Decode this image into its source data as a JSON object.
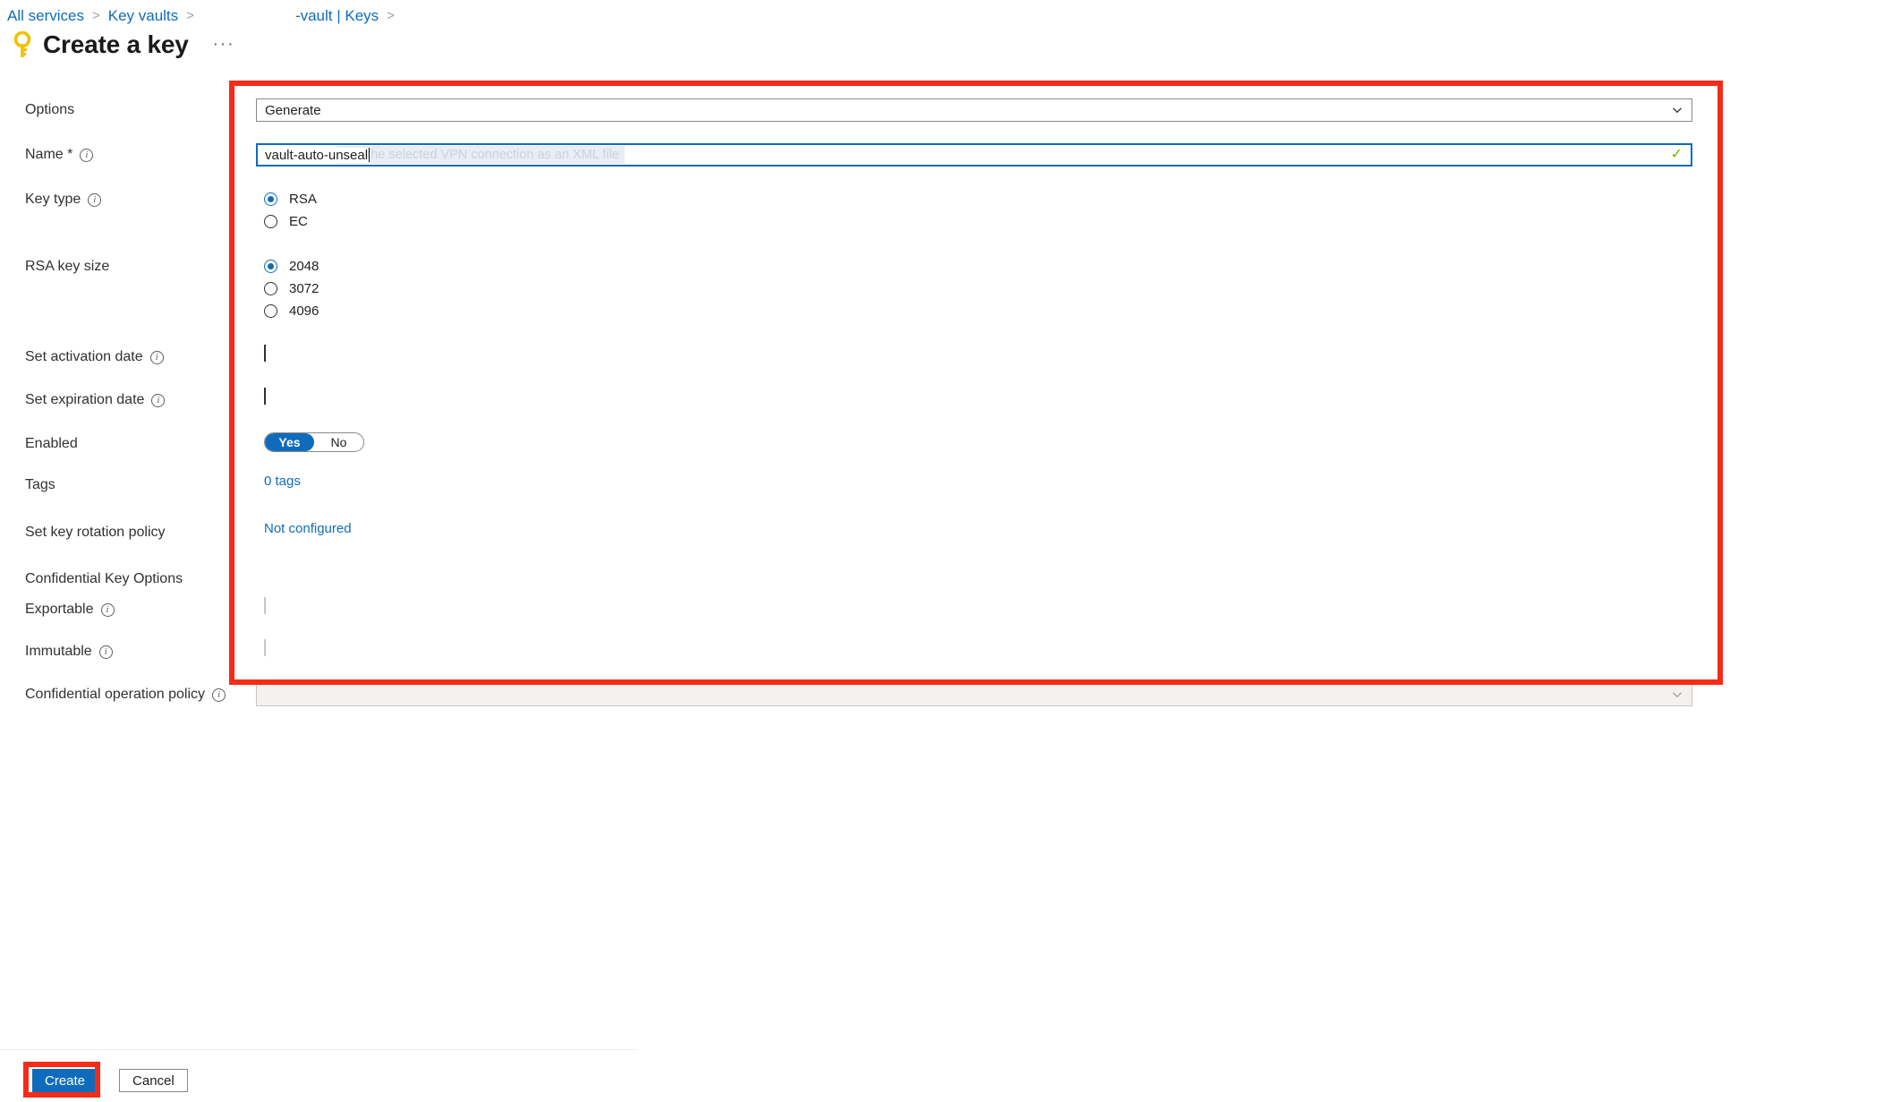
{
  "breadcrumb": {
    "all_services": "All services",
    "key_vaults": "Key vaults",
    "vault_keys": "-vault | Keys",
    "separator": ">"
  },
  "header": {
    "title": "Create a key",
    "icon": "key-icon",
    "more_menu": "···"
  },
  "form": {
    "options": {
      "label": "Options",
      "value": "Generate"
    },
    "name": {
      "label": "Name *",
      "value": "vault-auto-unseal",
      "ghost_tooltip": "orts the selected VPN connection as an XML file",
      "valid_mark": "✓"
    },
    "key_type": {
      "label": "Key type",
      "options": [
        "RSA",
        "EC"
      ],
      "selected": "RSA"
    },
    "rsa_key_size": {
      "label": "RSA key size",
      "options": [
        "2048",
        "3072",
        "4096"
      ],
      "selected": "2048"
    },
    "set_activation_date": {
      "label": "Set activation date",
      "checked": false
    },
    "set_expiration_date": {
      "label": "Set expiration date",
      "checked": false
    },
    "enabled": {
      "label": "Enabled",
      "yes": "Yes",
      "no": "No",
      "selected": "Yes"
    },
    "tags": {
      "label": "Tags",
      "value": "0 tags"
    },
    "key_rotation_policy": {
      "label": "Set key rotation policy",
      "value": "Not configured"
    },
    "confidential_key_options": {
      "label": "Confidential Key Options",
      "exportable": {
        "label": "Exportable",
        "checked": false,
        "disabled": true
      },
      "immutable": {
        "label": "Immutable",
        "checked": false,
        "disabled": true
      },
      "confidential_operation_policy": {
        "label": "Confidential operation policy",
        "value": "",
        "disabled": true
      }
    }
  },
  "footer": {
    "create": "Create",
    "cancel": "Cancel"
  },
  "colors": {
    "accent": "#0f6cbd",
    "annotation": "#f62b18",
    "valid": "#6bb700",
    "disabled_bg": "#f3f2f1"
  }
}
